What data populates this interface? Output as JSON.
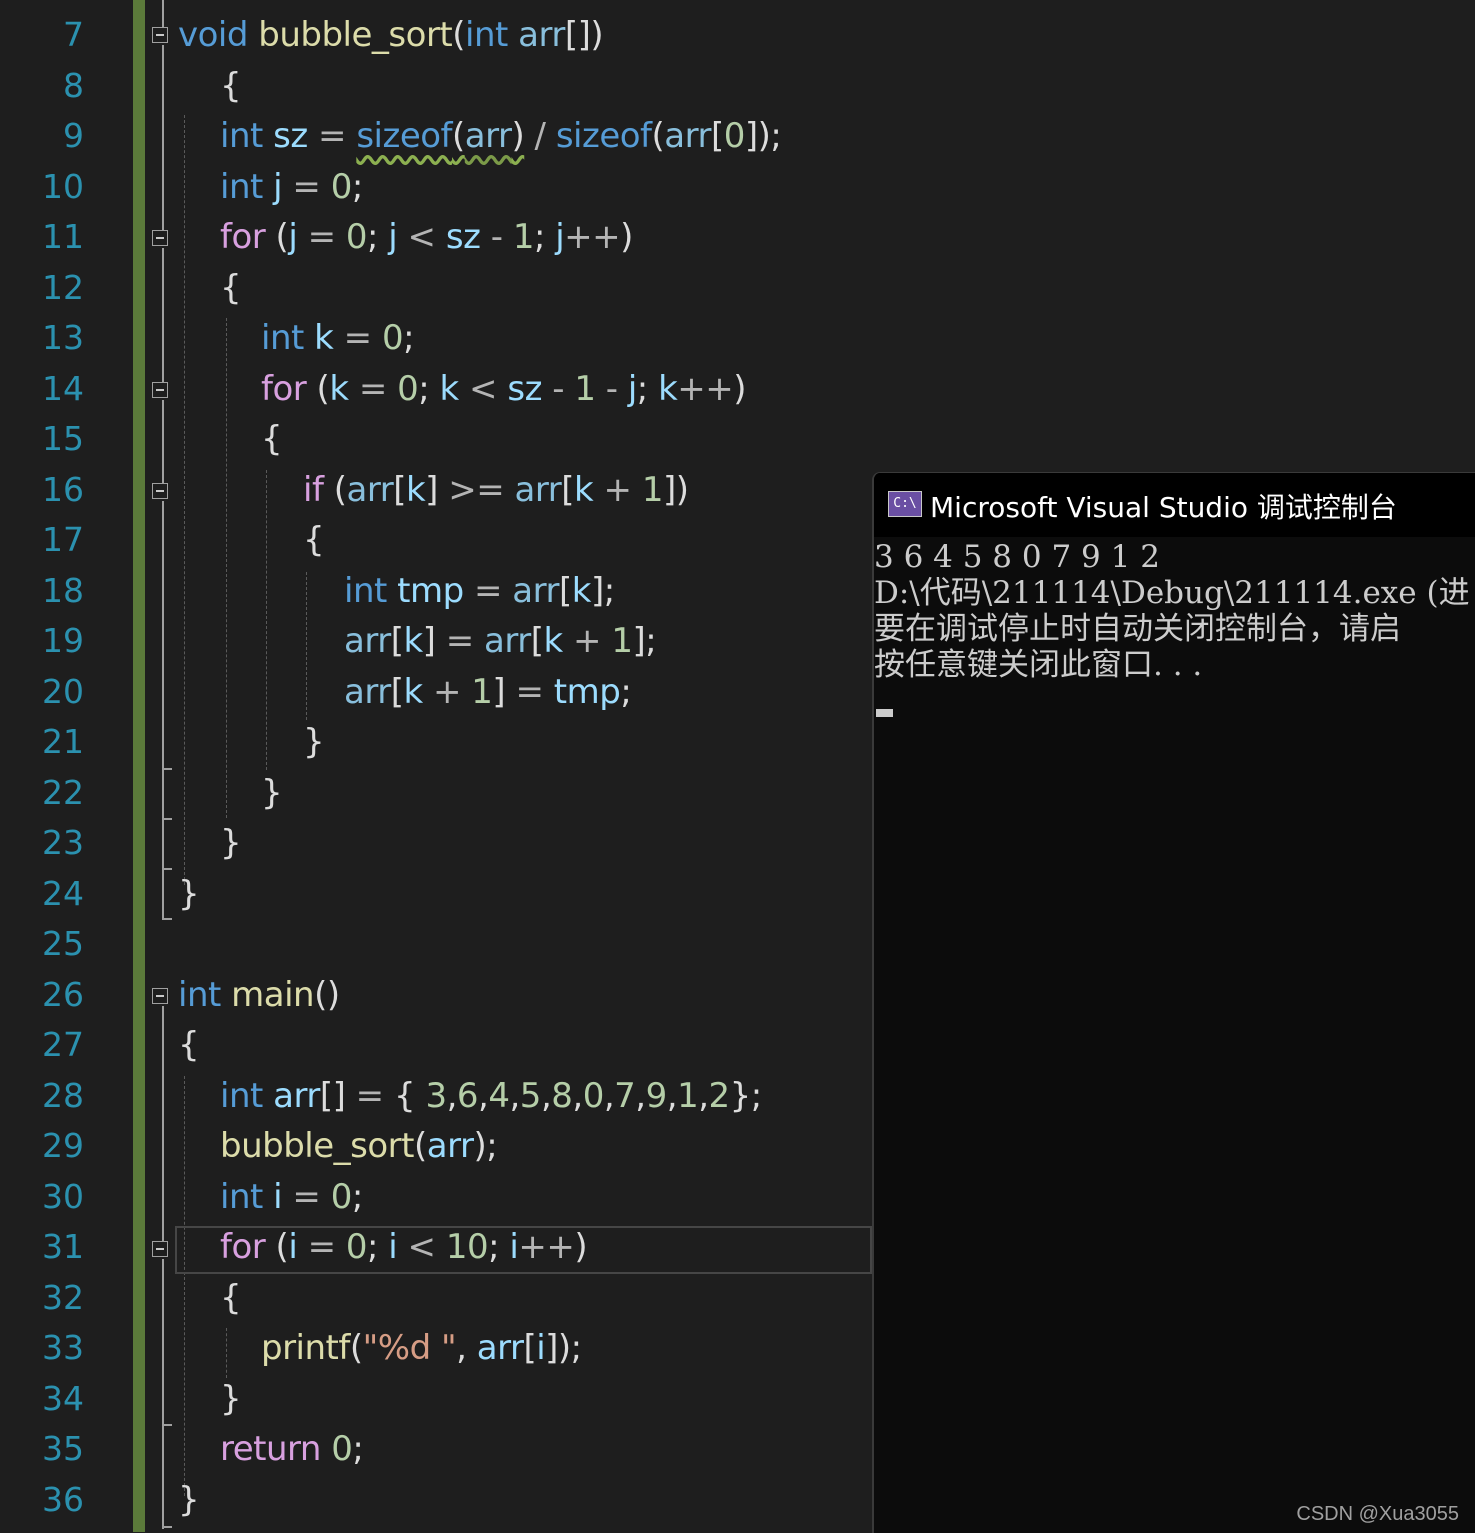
{
  "editor": {
    "line_numbers": [
      "7",
      "8",
      "9",
      "10",
      "11",
      "12",
      "13",
      "14",
      "15",
      "16",
      "17",
      "18",
      "19",
      "20",
      "21",
      "22",
      "23",
      "24",
      "25",
      "26",
      "27",
      "28",
      "29",
      "30",
      "31",
      "32",
      "33",
      "34",
      "35",
      "36"
    ],
    "lines": [
      {
        "tokens": [
          [
            "kw",
            "void"
          ],
          [
            "pun",
            " "
          ],
          [
            "fn",
            "bubble_sort"
          ],
          [
            "pun",
            "("
          ],
          [
            "kw",
            "int"
          ],
          [
            "pun",
            " "
          ],
          [
            "par",
            "arr"
          ],
          [
            "pun",
            "[])"
          ]
        ]
      },
      {
        "tokens": [
          [
            "pun",
            "{"
          ]
        ]
      },
      {
        "tokens": [
          [
            "kw",
            "int"
          ],
          [
            "pun",
            " "
          ],
          [
            "var",
            "sz"
          ],
          [
            "op",
            " = "
          ],
          [
            "kw sq",
            "sizeof"
          ],
          [
            "pun sq",
            "("
          ],
          [
            "par sq",
            "arr"
          ],
          [
            "pun sq",
            ")"
          ],
          [
            "op",
            " / "
          ],
          [
            "kw",
            "sizeof"
          ],
          [
            "pun",
            "("
          ],
          [
            "par",
            "arr"
          ],
          [
            "pun",
            "["
          ],
          [
            "num",
            "0"
          ],
          [
            "pun",
            "]);"
          ]
        ]
      },
      {
        "tokens": [
          [
            "kw",
            "int"
          ],
          [
            "pun",
            " "
          ],
          [
            "var",
            "j"
          ],
          [
            "op",
            " = "
          ],
          [
            "num",
            "0"
          ],
          [
            "pun",
            ";"
          ]
        ]
      },
      {
        "tokens": [
          [
            "ctl",
            "for"
          ],
          [
            "pun",
            " ("
          ],
          [
            "var",
            "j"
          ],
          [
            "op",
            " = "
          ],
          [
            "num",
            "0"
          ],
          [
            "pun",
            "; "
          ],
          [
            "var",
            "j"
          ],
          [
            "op",
            " < "
          ],
          [
            "var",
            "sz"
          ],
          [
            "op",
            " - "
          ],
          [
            "num",
            "1"
          ],
          [
            "pun",
            "; "
          ],
          [
            "var",
            "j"
          ],
          [
            "op",
            "++"
          ],
          [
            "pun",
            ")"
          ]
        ]
      },
      {
        "tokens": [
          [
            "pun",
            "{"
          ]
        ]
      },
      {
        "tokens": [
          [
            "kw",
            "int"
          ],
          [
            "pun",
            " "
          ],
          [
            "var",
            "k"
          ],
          [
            "op",
            " = "
          ],
          [
            "num",
            "0"
          ],
          [
            "pun",
            ";"
          ]
        ]
      },
      {
        "tokens": [
          [
            "ctl",
            "for"
          ],
          [
            "pun",
            " ("
          ],
          [
            "var",
            "k"
          ],
          [
            "op",
            " = "
          ],
          [
            "num",
            "0"
          ],
          [
            "pun",
            "; "
          ],
          [
            "var",
            "k"
          ],
          [
            "op",
            " < "
          ],
          [
            "var",
            "sz"
          ],
          [
            "op",
            " - "
          ],
          [
            "num",
            "1"
          ],
          [
            "op",
            " - "
          ],
          [
            "var",
            "j"
          ],
          [
            "pun",
            "; "
          ],
          [
            "var",
            "k"
          ],
          [
            "op",
            "++"
          ],
          [
            "pun",
            ")"
          ]
        ]
      },
      {
        "tokens": [
          [
            "pun",
            "{"
          ]
        ]
      },
      {
        "tokens": [
          [
            "ctl",
            "if"
          ],
          [
            "pun",
            " ("
          ],
          [
            "par",
            "arr"
          ],
          [
            "pun",
            "["
          ],
          [
            "var",
            "k"
          ],
          [
            "pun",
            "]"
          ],
          [
            "op",
            " >= "
          ],
          [
            "par",
            "arr"
          ],
          [
            "pun",
            "["
          ],
          [
            "var",
            "k"
          ],
          [
            "op",
            " + "
          ],
          [
            "num",
            "1"
          ],
          [
            "pun",
            "])"
          ]
        ]
      },
      {
        "tokens": [
          [
            "pun",
            "{"
          ]
        ]
      },
      {
        "tokens": [
          [
            "kw",
            "int"
          ],
          [
            "pun",
            " "
          ],
          [
            "var",
            "tmp"
          ],
          [
            "op",
            " = "
          ],
          [
            "par",
            "arr"
          ],
          [
            "pun",
            "["
          ],
          [
            "var",
            "k"
          ],
          [
            "pun",
            "];"
          ]
        ]
      },
      {
        "tokens": [
          [
            "par",
            "arr"
          ],
          [
            "pun",
            "["
          ],
          [
            "var",
            "k"
          ],
          [
            "pun",
            "]"
          ],
          [
            "op",
            " = "
          ],
          [
            "par",
            "arr"
          ],
          [
            "pun",
            "["
          ],
          [
            "var",
            "k"
          ],
          [
            "op",
            " + "
          ],
          [
            "num",
            "1"
          ],
          [
            "pun",
            "];"
          ]
        ]
      },
      {
        "tokens": [
          [
            "par",
            "arr"
          ],
          [
            "pun",
            "["
          ],
          [
            "var",
            "k"
          ],
          [
            "op",
            " + "
          ],
          [
            "num",
            "1"
          ],
          [
            "pun",
            "]"
          ],
          [
            "op",
            " = "
          ],
          [
            "var",
            "tmp"
          ],
          [
            "pun",
            ";"
          ]
        ]
      },
      {
        "tokens": [
          [
            "pun",
            "}"
          ]
        ]
      },
      {
        "tokens": [
          [
            "pun",
            "}"
          ]
        ]
      },
      {
        "tokens": [
          [
            "pun",
            "}"
          ]
        ]
      },
      {
        "tokens": [
          [
            "pun",
            "}"
          ]
        ]
      },
      {
        "tokens": []
      },
      {
        "tokens": [
          [
            "kw",
            "int"
          ],
          [
            "pun",
            " "
          ],
          [
            "fn",
            "main"
          ],
          [
            "pun",
            "()"
          ]
        ]
      },
      {
        "tokens": [
          [
            "pun",
            "{"
          ]
        ]
      },
      {
        "tokens": [
          [
            "kw",
            "int"
          ],
          [
            "pun",
            " "
          ],
          [
            "var",
            "arr"
          ],
          [
            "pun",
            "[]"
          ],
          [
            "op",
            " = "
          ],
          [
            "pun",
            "{ "
          ],
          [
            "num",
            "3"
          ],
          [
            "pun",
            ","
          ],
          [
            "num",
            "6"
          ],
          [
            "pun",
            ","
          ],
          [
            "num",
            "4"
          ],
          [
            "pun",
            ","
          ],
          [
            "num",
            "5"
          ],
          [
            "pun",
            ","
          ],
          [
            "num",
            "8"
          ],
          [
            "pun",
            ","
          ],
          [
            "num",
            "0"
          ],
          [
            "pun",
            ","
          ],
          [
            "num",
            "7"
          ],
          [
            "pun",
            ","
          ],
          [
            "num",
            "9"
          ],
          [
            "pun",
            ","
          ],
          [
            "num",
            "1"
          ],
          [
            "pun",
            ","
          ],
          [
            "num",
            "2"
          ],
          [
            "pun",
            "};"
          ]
        ]
      },
      {
        "tokens": [
          [
            "fn",
            "bubble_sort"
          ],
          [
            "pun",
            "("
          ],
          [
            "var",
            "arr"
          ],
          [
            "pun",
            ");"
          ]
        ]
      },
      {
        "tokens": [
          [
            "kw",
            "int"
          ],
          [
            "pun",
            " "
          ],
          [
            "var",
            "i"
          ],
          [
            "op",
            " = "
          ],
          [
            "num",
            "0"
          ],
          [
            "pun",
            ";"
          ]
        ]
      },
      {
        "tokens": [
          [
            "ctl",
            "for"
          ],
          [
            "pun",
            " ("
          ],
          [
            "var",
            "i"
          ],
          [
            "op",
            " = "
          ],
          [
            "num",
            "0"
          ],
          [
            "pun",
            "; "
          ],
          [
            "var",
            "i"
          ],
          [
            "op",
            " < "
          ],
          [
            "num",
            "10"
          ],
          [
            "pun",
            "; "
          ],
          [
            "var",
            "i"
          ],
          [
            "op",
            "++"
          ],
          [
            "pun",
            ")"
          ]
        ]
      },
      {
        "tokens": [
          [
            "pun",
            "{"
          ]
        ]
      },
      {
        "tokens": [
          [
            "fn",
            "printf"
          ],
          [
            "pun",
            "("
          ],
          [
            "str",
            "\"%d \""
          ],
          [
            "pun",
            ", "
          ],
          [
            "var",
            "arr"
          ],
          [
            "pun",
            "["
          ],
          [
            "var",
            "i"
          ],
          [
            "pun",
            "]);"
          ]
        ]
      },
      {
        "tokens": [
          [
            "pun",
            "}"
          ]
        ]
      },
      {
        "tokens": [
          [
            "ctl",
            "return"
          ],
          [
            "pun",
            " "
          ],
          [
            "num",
            "0"
          ],
          [
            "pun",
            ";"
          ]
        ]
      },
      {
        "tokens": [
          [
            "pun",
            "}"
          ]
        ]
      }
    ]
  },
  "console": {
    "icon_text": "C:\\",
    "title": "Microsoft Visual Studio 调试控制台",
    "output": [
      "3 6 4 5 8 0 7 9 1 2",
      "D:\\代码\\211114\\Debug\\211114.exe (进",
      "要在调试停止时自动关闭控制台，请启",
      "按任意键关闭此窗口. . ."
    ]
  },
  "watermark": "CSDN @Xua3055"
}
